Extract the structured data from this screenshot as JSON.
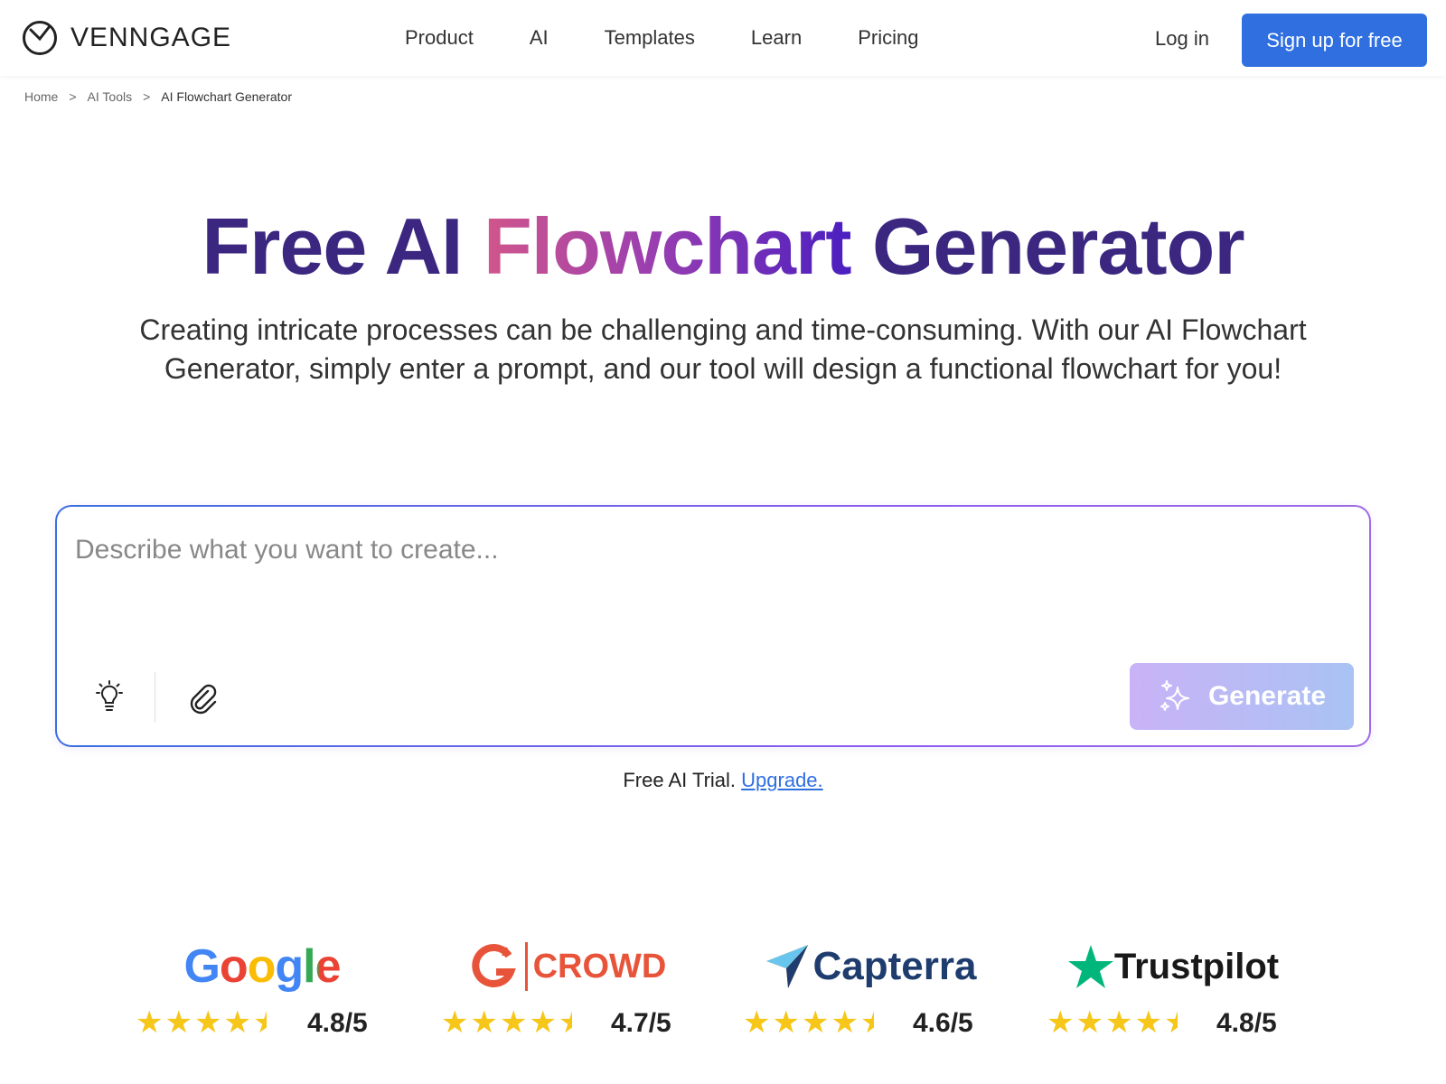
{
  "header": {
    "logo_text": "VENNGAGE",
    "nav": [
      "Product",
      "AI",
      "Templates",
      "Learn",
      "Pricing"
    ],
    "login_label": "Log in",
    "signup_label": "Sign up for free"
  },
  "breadcrumb": {
    "items": [
      "Home",
      "AI Tools",
      "AI Flowchart Generator"
    ],
    "separator": ">"
  },
  "hero": {
    "title_before": "Free AI ",
    "title_highlight": "Flowchart",
    "title_after": " Generator",
    "subtitle": "Creating intricate processes can be challenging and time-consuming. With our AI Flowchart Generator, simply enter a prompt, and our tool will design a functional flowchart for you!"
  },
  "prompt": {
    "placeholder": "Describe what you want to create...",
    "value": "",
    "generate_label": "Generate"
  },
  "trial": {
    "text": "Free AI Trial.",
    "upgrade_label": "Upgrade."
  },
  "ratings": [
    {
      "brand": "Google",
      "score": "4.8/5",
      "stars": 4.5
    },
    {
      "brand": "CROWD",
      "score": "4.7/5",
      "stars": 4.5
    },
    {
      "brand": "Capterra",
      "score": "4.6/5",
      "stars": 4.5
    },
    {
      "brand": "Trustpilot",
      "score": "4.8/5",
      "stars": 4.5
    }
  ],
  "colors": {
    "primary": "#2f6fe0",
    "title": "#3b2680",
    "star": "#f6c619"
  }
}
